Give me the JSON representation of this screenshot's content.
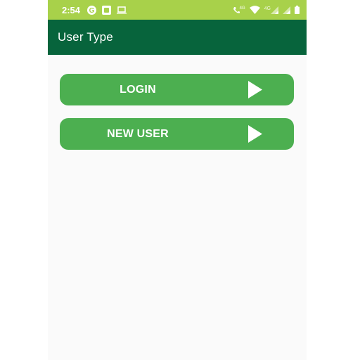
{
  "status_bar": {
    "time": "2:54",
    "icons": [
      "google-g-icon",
      "notification-icon",
      "laptop-icon",
      "wifi-call-icon",
      "wifi-icon",
      "signal-4g-icon",
      "signal-icon",
      "battery-icon"
    ],
    "network_label": "4G",
    "call_label": "4G"
  },
  "app_bar": {
    "title": "User Type"
  },
  "buttons": [
    {
      "label": "LOGIN",
      "icon": "play-arrow-icon"
    },
    {
      "label": "NEW USER",
      "icon": "play-arrow-icon"
    }
  ],
  "colors": {
    "status_bar": "#a8d14a",
    "app_bar": "#07643c",
    "button": "#4caf50",
    "background": "#fafafa"
  }
}
